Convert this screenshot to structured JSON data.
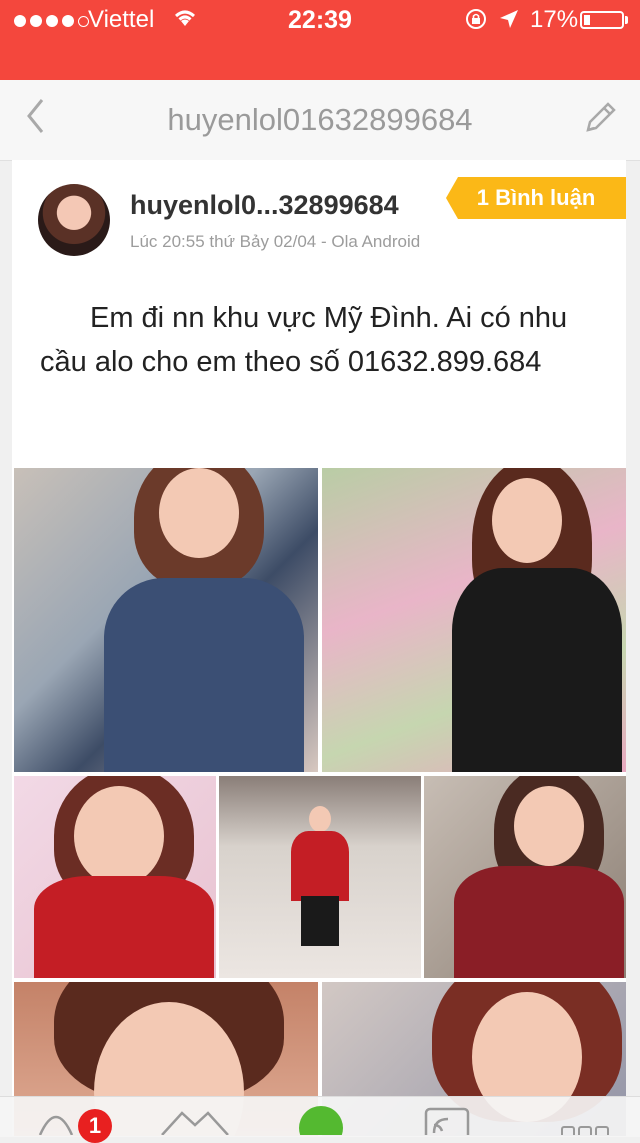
{
  "status_bar": {
    "carrier": "Viettel",
    "time": "22:39",
    "battery": "17%"
  },
  "nav": {
    "title": "huyenlol01632899684"
  },
  "post": {
    "author": "huyenlol0...32899684",
    "meta": "Lúc 20:55 thứ Bảy 02/04 - Ola Android",
    "comment_badge": "1 Bình luận",
    "text": "Em đi nn khu vực Mỹ Đình. Ai có nhu cầu alo cho em theo số 01632.899.684"
  },
  "tabbar": {
    "notification_count": "1"
  },
  "colors": {
    "header_red": "#f4473d",
    "badge_yellow": "#fbb817",
    "notif_red": "#e82020"
  }
}
